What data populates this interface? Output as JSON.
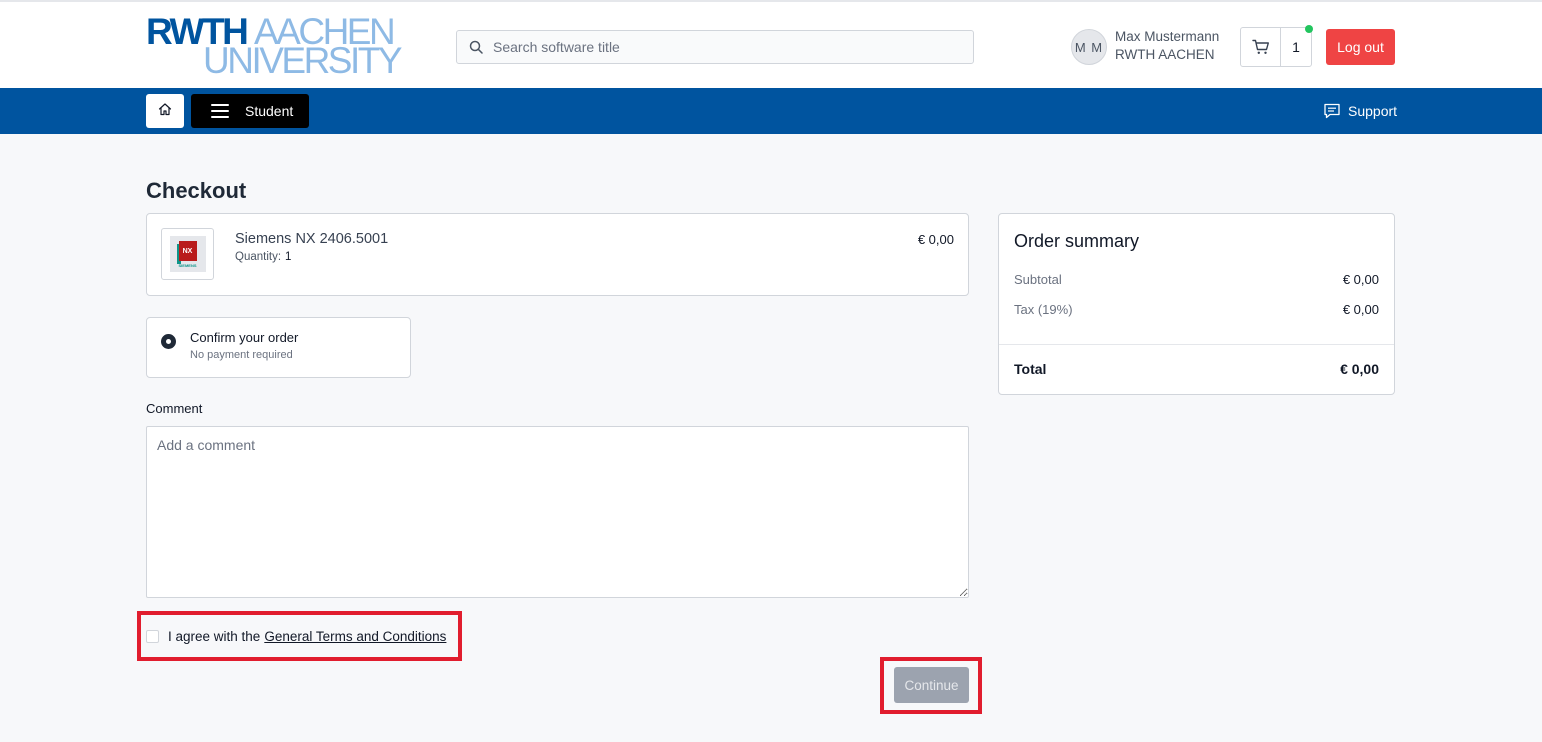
{
  "header": {
    "logo": {
      "line1_bold": "RWTH",
      "line1_light": "AACHEN",
      "line2": "UNIVERSITY"
    },
    "search_placeholder": "Search software title",
    "user": {
      "initials": "M M",
      "name": "Max Mustermann",
      "org": "RWTH AACHEN"
    },
    "cart_count": "1",
    "logout_label": "Log out"
  },
  "nav": {
    "menu_label": "Student",
    "support_label": "Support"
  },
  "checkout": {
    "title": "Checkout",
    "item": {
      "name": "Siemens NX 2406.5001",
      "quantity_label": "Quantity:",
      "quantity": "1",
      "price": "€ 0,00",
      "thumb_text": "NX",
      "thumb_subtext": "SIEMENS"
    },
    "payment": {
      "title": "Confirm your order",
      "subtitle": "No payment required"
    },
    "comment_label": "Comment",
    "comment_placeholder": "Add a comment",
    "terms_prefix": "I agree with the",
    "terms_link": "General Terms and Conditions",
    "continue_label": "Continue"
  },
  "summary": {
    "title": "Order summary",
    "subtotal_label": "Subtotal",
    "subtotal_value": "€ 0,00",
    "tax_label": "Tax (19%)",
    "tax_value": "€ 0,00",
    "total_label": "Total",
    "total_value": "€ 0,00"
  },
  "colors": {
    "brand_blue": "#00549f",
    "brand_light_blue": "#8ebae5",
    "logout_red": "#ef4444",
    "highlight_red": "#e11d2e",
    "cart_status_green": "#22c55e"
  }
}
